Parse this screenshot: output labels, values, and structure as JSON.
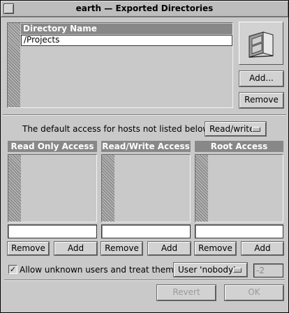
{
  "window": {
    "title": "earth  —  Exported Directories"
  },
  "directories": {
    "header": "Directory Name",
    "rows": [
      "/Projects"
    ],
    "add_label": "Add...",
    "remove_label": "Remove"
  },
  "default_access": {
    "label": "The default access for hosts not listed below is:",
    "value": "Read/write"
  },
  "panels": [
    {
      "title": "Read Only Access",
      "remove_label": "Remove",
      "add_label": "Add"
    },
    {
      "title": "Read/Write Access",
      "remove_label": "Remove",
      "add_label": "Add"
    },
    {
      "title": "Root Access",
      "remove_label": "Remove",
      "add_label": "Add"
    }
  ],
  "unknown_users": {
    "checked": true,
    "checkbox_glyph": "✓",
    "label": "Allow unknown users and treat them as:",
    "value": "User 'nobody'",
    "uid": "-2"
  },
  "footer": {
    "revert_label": "Revert",
    "ok_label": "OK"
  }
}
